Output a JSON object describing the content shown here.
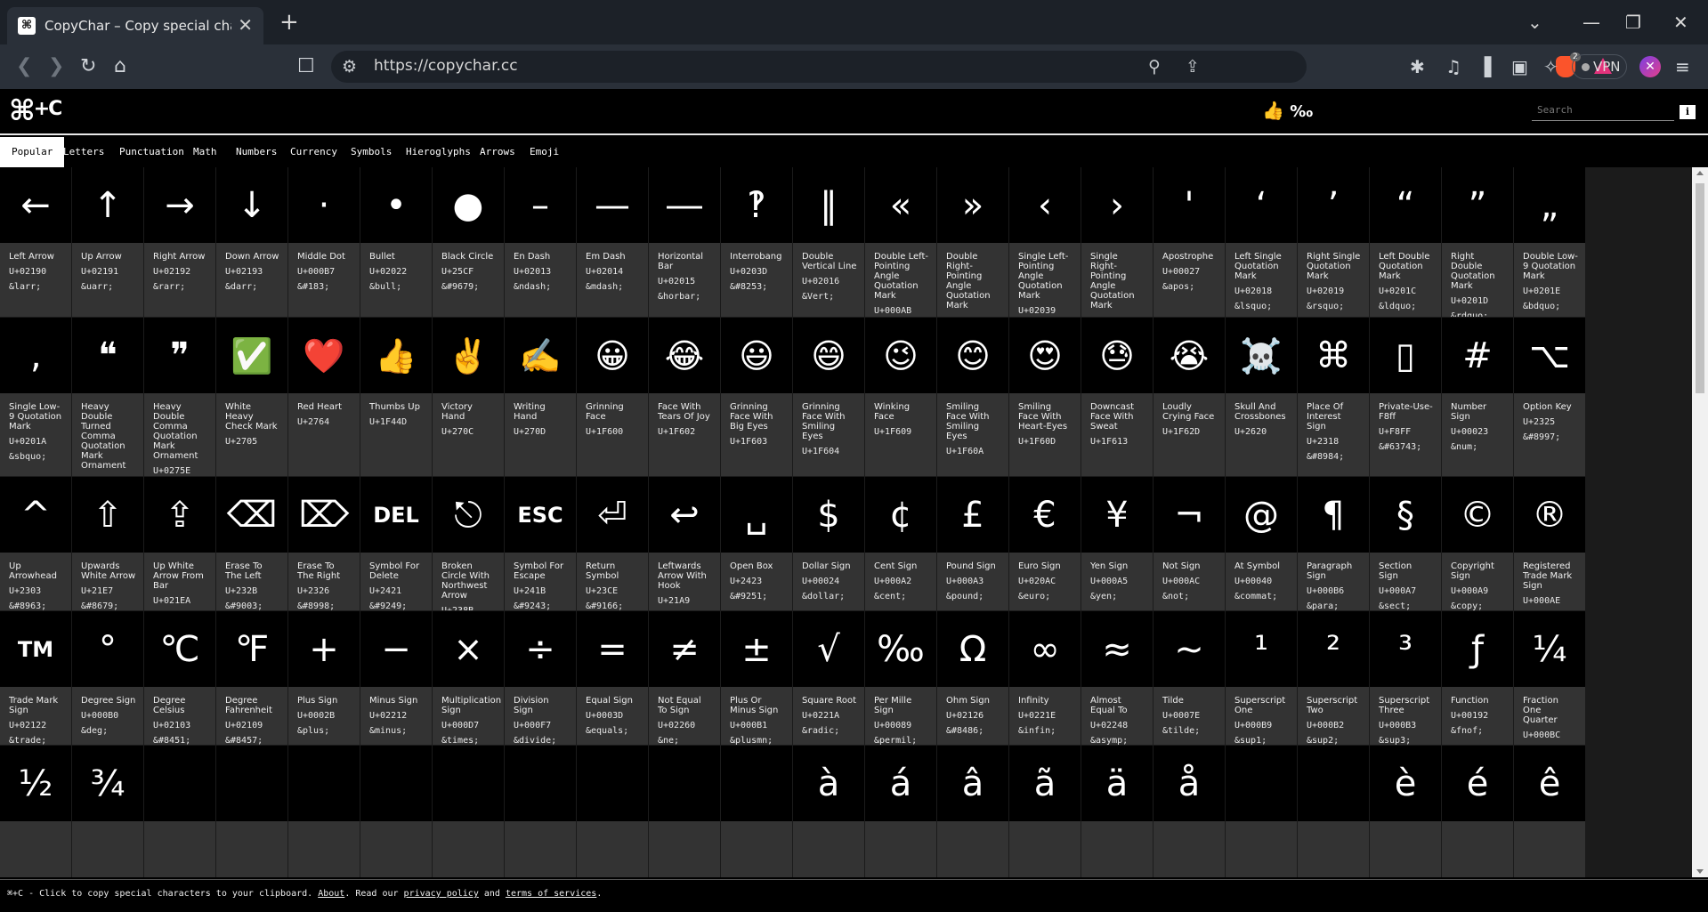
{
  "browser": {
    "tab_title": "CopyChar – Copy special characters",
    "tab_favicon": "⌘",
    "url": "https://copychar.cc",
    "vpn_label": "VPN",
    "brave_badge": "2"
  },
  "header": {
    "logo_main": "⌘",
    "logo_small": "+C",
    "permille_text": "‰",
    "search_placeholder": "Search",
    "info_label": "i"
  },
  "categories": [
    {
      "label": "Popular",
      "active": true
    },
    {
      "label": "Letters"
    },
    {
      "label": "Punctuation"
    },
    {
      "label": "Math"
    },
    {
      "label": "Numbers"
    },
    {
      "label": "Currency"
    },
    {
      "label": "Symbols"
    },
    {
      "label": "Hieroglyphs"
    },
    {
      "label": "Arrows"
    },
    {
      "label": "Emoji"
    }
  ],
  "rows": [
    [
      {
        "g": "←",
        "name": "Left Arrow",
        "code": "U+02190",
        "ent": "&larr;"
      },
      {
        "g": "↑",
        "name": "Up Arrow",
        "code": "U+02191",
        "ent": "&uarr;"
      },
      {
        "g": "→",
        "name": "Right Arrow",
        "code": "U+02192",
        "ent": "&rarr;"
      },
      {
        "g": "↓",
        "name": "Down Arrow",
        "code": "U+02193",
        "ent": "&darr;"
      },
      {
        "g": "·",
        "name": "Middle Dot",
        "code": "U+000B7",
        "ent": "&#183;"
      },
      {
        "g": "•",
        "name": "Bullet",
        "code": "U+02022",
        "ent": "&bull;"
      },
      {
        "g": "●",
        "name": "Black Circle",
        "code": "U+25CF",
        "ent": "&#9679;"
      },
      {
        "g": "–",
        "name": "En Dash",
        "code": "U+02013",
        "ent": "&ndash;"
      },
      {
        "g": "—",
        "name": "Em Dash",
        "code": "U+02014",
        "ent": "&mdash;"
      },
      {
        "g": "―",
        "name": "Horizontal Bar",
        "code": "U+02015",
        "ent": "&horbar;"
      },
      {
        "g": "‽",
        "name": "Interrobang",
        "code": "U+0203D",
        "ent": "&#8253;"
      },
      {
        "g": "‖",
        "name": "Double Vertical Line",
        "code": "U+02016",
        "ent": "&Vert;"
      },
      {
        "g": "«",
        "name": "Double Left-Pointing Angle Quotation Mark",
        "code": "U+000AB",
        "ent": "&laquo;"
      },
      {
        "g": "»",
        "name": "Double Right-Pointing Angle Quotation Mark",
        "code": "U+000BB",
        "ent": "&raquo;"
      },
      {
        "g": "‹",
        "name": "Single Left-Pointing Angle Quotation Mark",
        "code": "U+02039",
        "ent": "&lsaquo;"
      },
      {
        "g": "›",
        "name": "Single Right-Pointing Angle Quotation Mark",
        "code": "U+0203A",
        "ent": "&rsaquo;"
      },
      {
        "g": "'",
        "name": "Apostrophe",
        "code": "U+00027",
        "ent": "&apos;"
      },
      {
        "g": "‘",
        "name": "Left Single Quotation Mark",
        "code": "U+02018",
        "ent": "&lsquo;"
      },
      {
        "g": "’",
        "name": "Right Single Quotation Mark",
        "code": "U+02019",
        "ent": "&rsquo;"
      },
      {
        "g": "“",
        "name": "Left Double Quotation Mark",
        "code": "U+0201C",
        "ent": "&ldquo;"
      },
      {
        "g": "”",
        "name": "Right Double Quotation Mark",
        "code": "U+0201D",
        "ent": "&rdquo;"
      },
      {
        "g": "„",
        "name": "Double Low-9 Quotation Mark",
        "code": "U+0201E",
        "ent": "&bdquo;"
      }
    ],
    [
      {
        "g": "‚",
        "name": "Single Low-9 Quotation Mark",
        "code": "U+0201A",
        "ent": "&sbquo;"
      },
      {
        "g": "❝",
        "name": "Heavy Double Turned Comma Quotation Mark Ornament",
        "code": "U+0275D",
        "ent": "&#10077;"
      },
      {
        "g": "❞",
        "name": "Heavy Double Comma Quotation Mark Ornament",
        "code": "U+0275E",
        "ent": "&#10078;"
      },
      {
        "g": "✅",
        "name": "White Heavy Check Mark",
        "code": "U+2705",
        "ent": "",
        "emoji": true
      },
      {
        "g": "❤️",
        "name": "Red Heart",
        "code": "U+2764",
        "ent": "",
        "emoji": true
      },
      {
        "g": "👍",
        "name": "Thumbs Up",
        "code": "U+1F44D",
        "ent": "",
        "emoji": true
      },
      {
        "g": "✌️",
        "name": "Victory Hand",
        "code": "U+270C",
        "ent": "",
        "emoji": true
      },
      {
        "g": "✍️",
        "name": "Writing Hand",
        "code": "U+270D",
        "ent": "",
        "emoji": true
      },
      {
        "g": "😀",
        "name": "Grinning Face",
        "code": "U+1F600",
        "ent": "",
        "emoji": true
      },
      {
        "g": "😂",
        "name": "Face With Tears Of Joy",
        "code": "U+1F602",
        "ent": "",
        "emoji": true
      },
      {
        "g": "😃",
        "name": "Grinning Face With Big Eyes",
        "code": "U+1F603",
        "ent": "",
        "emoji": true
      },
      {
        "g": "😄",
        "name": "Grinning Face With Smiling Eyes",
        "code": "U+1F604",
        "ent": "",
        "emoji": true
      },
      {
        "g": "😉",
        "name": "Winking Face",
        "code": "U+1F609",
        "ent": "",
        "emoji": true
      },
      {
        "g": "😊",
        "name": "Smiling Face With Smiling Eyes",
        "code": "U+1F60A",
        "ent": "",
        "emoji": true
      },
      {
        "g": "😍",
        "name": "Smiling Face With Heart-Eyes",
        "code": "U+1F60D",
        "ent": "",
        "emoji": true
      },
      {
        "g": "😓",
        "name": "Downcast Face With Sweat",
        "code": "U+1F613",
        "ent": "",
        "emoji": true
      },
      {
        "g": "😭",
        "name": "Loudly Crying Face",
        "code": "U+1F62D",
        "ent": "",
        "emoji": true
      },
      {
        "g": "☠️",
        "name": "Skull And Crossbones",
        "code": "U+2620",
        "ent": "",
        "emoji": true
      },
      {
        "g": "⌘",
        "name": "Place Of Interest Sign",
        "code": "U+2318",
        "ent": "&#8984;"
      },
      {
        "g": "▯",
        "name": "Private-Use-F8ff",
        "code": "U+F8FF",
        "ent": "&#63743;"
      },
      {
        "g": "#",
        "name": "Number Sign",
        "code": "U+00023",
        "ent": "&num;"
      },
      {
        "g": "⌥",
        "name": "Option Key",
        "code": "U+2325",
        "ent": "&#8997;"
      }
    ],
    [
      {
        "g": "^",
        "name": "Up Arrowhead",
        "code": "U+2303",
        "ent": "&#8963;"
      },
      {
        "g": "⇧",
        "name": "Upwards White Arrow",
        "code": "U+21E7",
        "ent": "&#8679;"
      },
      {
        "g": "⇪",
        "name": "Up White Arrow From Bar",
        "code": "U+021EA",
        "ent": "&#8682;"
      },
      {
        "g": "⌫",
        "name": "Erase To The Left",
        "code": "U+232B",
        "ent": "&#9003;"
      },
      {
        "g": "⌦",
        "name": "Erase To The Right",
        "code": "U+2326",
        "ent": "&#8998;"
      },
      {
        "g": "DEL",
        "name": "Symbol For Delete",
        "code": "U+2421",
        "ent": "&#9249;",
        "small": true
      },
      {
        "g": "⎋",
        "name": "Broken Circle With Northwest Arrow",
        "code": "U+238B",
        "ent": "&#9099;"
      },
      {
        "g": "ESC",
        "name": "Symbol For Escape",
        "code": "U+241B",
        "ent": "&#9243;",
        "small": true
      },
      {
        "g": "⏎",
        "name": "Return Symbol",
        "code": "U+23CE",
        "ent": "&#9166;"
      },
      {
        "g": "↩",
        "name": "Leftwards Arrow With Hook",
        "code": "U+21A9",
        "ent": "&#8617;"
      },
      {
        "g": "␣",
        "name": "Open Box",
        "code": "U+2423",
        "ent": "&#9251;"
      },
      {
        "g": "$",
        "name": "Dollar Sign",
        "code": "U+00024",
        "ent": "&dollar;"
      },
      {
        "g": "¢",
        "name": "Cent Sign",
        "code": "U+000A2",
        "ent": "&cent;"
      },
      {
        "g": "£",
        "name": "Pound Sign",
        "code": "U+000A3",
        "ent": "&pound;"
      },
      {
        "g": "€",
        "name": "Euro Sign",
        "code": "U+020AC",
        "ent": "&euro;"
      },
      {
        "g": "¥",
        "name": "Yen Sign",
        "code": "U+000A5",
        "ent": "&yen;"
      },
      {
        "g": "¬",
        "name": "Not Sign",
        "code": "U+000AC",
        "ent": "&not;"
      },
      {
        "g": "@",
        "name": "At Symbol",
        "code": "U+00040",
        "ent": "&commat;"
      },
      {
        "g": "¶",
        "name": "Paragraph Sign",
        "code": "U+000B6",
        "ent": "&para;"
      },
      {
        "g": "§",
        "name": "Section Sign",
        "code": "U+000A7",
        "ent": "&sect;"
      },
      {
        "g": "©",
        "name": "Copyright Sign",
        "code": "U+000A9",
        "ent": "&copy;"
      },
      {
        "g": "®",
        "name": "Registered Trade Mark Sign",
        "code": "U+000AE",
        "ent": "&reg;"
      }
    ],
    [
      {
        "g": "TM",
        "name": "Trade Mark Sign",
        "code": "U+02122",
        "ent": "&trade;",
        "small": true
      },
      {
        "g": "°",
        "name": "Degree Sign",
        "code": "U+000B0",
        "ent": "&deg;"
      },
      {
        "g": "℃",
        "name": "Degree Celsius",
        "code": "U+02103",
        "ent": "&#8451;"
      },
      {
        "g": "℉",
        "name": "Degree Fahrenheit",
        "code": "U+02109",
        "ent": "&#8457;"
      },
      {
        "g": "+",
        "name": "Plus Sign",
        "code": "U+0002B",
        "ent": "&plus;"
      },
      {
        "g": "−",
        "name": "Minus Sign",
        "code": "U+02212",
        "ent": "&minus;"
      },
      {
        "g": "×",
        "name": "Multiplication Sign",
        "code": "U+000D7",
        "ent": "&times;"
      },
      {
        "g": "÷",
        "name": "Division Sign",
        "code": "U+000F7",
        "ent": "&divide;"
      },
      {
        "g": "=",
        "name": "Equal Sign",
        "code": "U+0003D",
        "ent": "&equals;"
      },
      {
        "g": "≠",
        "name": "Not Equal To Sign",
        "code": "U+02260",
        "ent": "&ne;"
      },
      {
        "g": "±",
        "name": "Plus Or Minus Sign",
        "code": "U+000B1",
        "ent": "&plusmn;"
      },
      {
        "g": "√",
        "name": "Square Root",
        "code": "U+0221A",
        "ent": "&radic;"
      },
      {
        "g": "‰",
        "name": "Per Mille Sign",
        "code": "U+00089",
        "ent": "&permil;"
      },
      {
        "g": "Ω",
        "name": "Ohm Sign",
        "code": "U+02126",
        "ent": "&#8486;"
      },
      {
        "g": "∞",
        "name": "Infinity",
        "code": "U+0221E",
        "ent": "&infin;"
      },
      {
        "g": "≈",
        "name": "Almost Equal To",
        "code": "U+02248",
        "ent": "&asymp;"
      },
      {
        "g": "~",
        "name": "Tilde",
        "code": "U+0007E",
        "ent": "&tilde;"
      },
      {
        "g": "¹",
        "name": "Superscript One",
        "code": "U+000B9",
        "ent": "&sup1;"
      },
      {
        "g": "²",
        "name": "Superscript Two",
        "code": "U+000B2",
        "ent": "&sup2;"
      },
      {
        "g": "³",
        "name": "Superscript Three",
        "code": "U+000B3",
        "ent": "&sup3;"
      },
      {
        "g": "ƒ",
        "name": "Function",
        "code": "U+00192",
        "ent": "&fnof;"
      },
      {
        "g": "¼",
        "name": "Fraction One Quarter",
        "code": "U+000BC",
        "ent": "&frac14;"
      }
    ],
    [
      {
        "g": "½",
        "name": "",
        "code": "",
        "ent": ""
      },
      {
        "g": "¾",
        "name": "",
        "code": "",
        "ent": ""
      },
      {
        "g": "",
        "name": "",
        "code": "",
        "ent": ""
      },
      {
        "g": "",
        "name": "",
        "code": "",
        "ent": ""
      },
      {
        "g": "",
        "name": "",
        "code": "",
        "ent": ""
      },
      {
        "g": "",
        "name": "",
        "code": "",
        "ent": ""
      },
      {
        "g": "",
        "name": "",
        "code": "",
        "ent": ""
      },
      {
        "g": "",
        "name": "",
        "code": "",
        "ent": ""
      },
      {
        "g": "",
        "name": "",
        "code": "",
        "ent": ""
      },
      {
        "g": "",
        "name": "",
        "code": "",
        "ent": ""
      },
      {
        "g": "",
        "name": "",
        "code": "",
        "ent": ""
      },
      {
        "g": "à",
        "name": "",
        "code": "",
        "ent": ""
      },
      {
        "g": "á",
        "name": "",
        "code": "",
        "ent": ""
      },
      {
        "g": "â",
        "name": "",
        "code": "",
        "ent": ""
      },
      {
        "g": "ã",
        "name": "",
        "code": "",
        "ent": ""
      },
      {
        "g": "ä",
        "name": "",
        "code": "",
        "ent": ""
      },
      {
        "g": "å",
        "name": "",
        "code": "",
        "ent": ""
      },
      {
        "g": "",
        "name": "",
        "code": "",
        "ent": ""
      },
      {
        "g": "",
        "name": "",
        "code": "",
        "ent": ""
      },
      {
        "g": "è",
        "name": "",
        "code": "",
        "ent": ""
      },
      {
        "g": "é",
        "name": "",
        "code": "",
        "ent": ""
      },
      {
        "g": "ê",
        "name": "",
        "code": "",
        "ent": ""
      }
    ]
  ],
  "footer": {
    "prefix": "⌘+C - Click to copy special characters to your clipboard. ",
    "about": "About",
    "middle": ". Read our ",
    "privacy": "privacy policy",
    "and": " and ",
    "terms": "terms of services",
    "end": "."
  }
}
